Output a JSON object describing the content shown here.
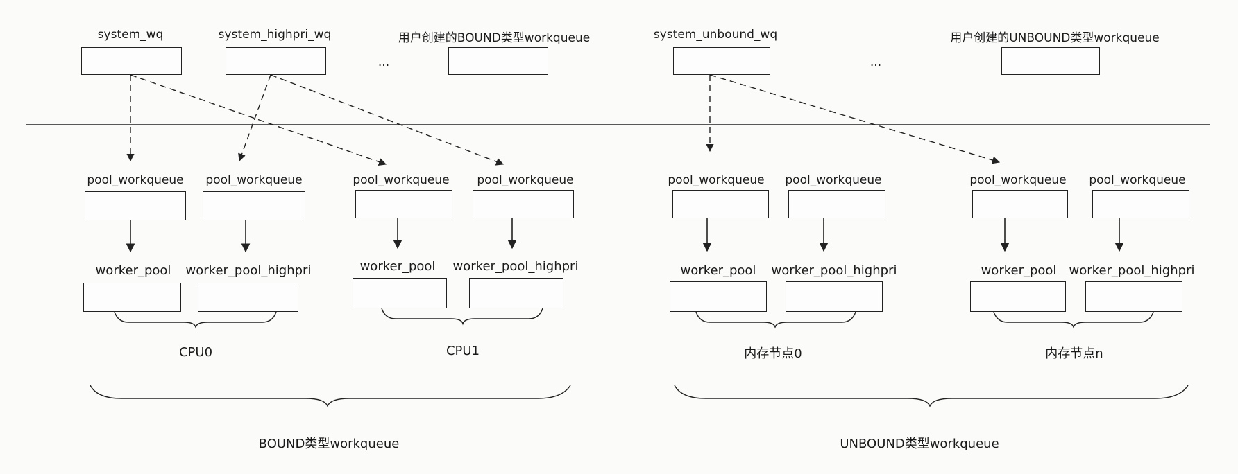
{
  "top": {
    "system_wq": "system_wq",
    "system_highpri_wq": "system_highpri_wq",
    "user_bound": "用户创建的BOUND类型workqueue",
    "system_unbound_wq": "system_unbound_wq",
    "user_unbound": "用户创建的UNBOUND类型workqueue",
    "ellipsis": "..."
  },
  "pool_workqueue": "pool_workqueue",
  "worker_pool": "worker_pool",
  "worker_pool_highpri": "worker_pool_highpri",
  "groups": {
    "cpu0": "CPU0",
    "cpu1": "CPU1",
    "node0": "内存节点0",
    "noden": "内存节点n"
  },
  "sections": {
    "bound": "BOUND类型workqueue",
    "unbound": "UNBOUND类型workqueue"
  }
}
